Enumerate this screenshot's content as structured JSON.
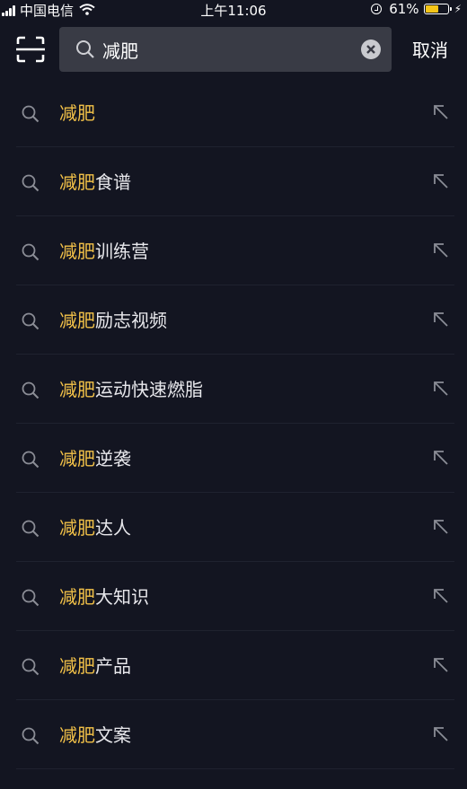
{
  "status_bar": {
    "carrier": "中国电信",
    "time": "上午11:06",
    "battery_text": "61%",
    "battery_level": 0.61
  },
  "search": {
    "query": "减肥",
    "cancel_label": "取消"
  },
  "colors": {
    "background": "#131521",
    "highlight": "#f2c148",
    "search_box": "#393b45"
  },
  "suggestions": [
    {
      "highlight": "减肥",
      "rest": ""
    },
    {
      "highlight": "减肥",
      "rest": "食谱"
    },
    {
      "highlight": "减肥",
      "rest": "训练营"
    },
    {
      "highlight": "减肥",
      "rest": "励志视频"
    },
    {
      "highlight": "减肥",
      "rest": "运动快速燃脂"
    },
    {
      "highlight": "减肥",
      "rest": "逆袭"
    },
    {
      "highlight": "减肥",
      "rest": "达人"
    },
    {
      "highlight": "减肥",
      "rest": "大知识"
    },
    {
      "highlight": "减肥",
      "rest": "产品"
    },
    {
      "highlight": "减肥",
      "rest": "文案"
    }
  ]
}
